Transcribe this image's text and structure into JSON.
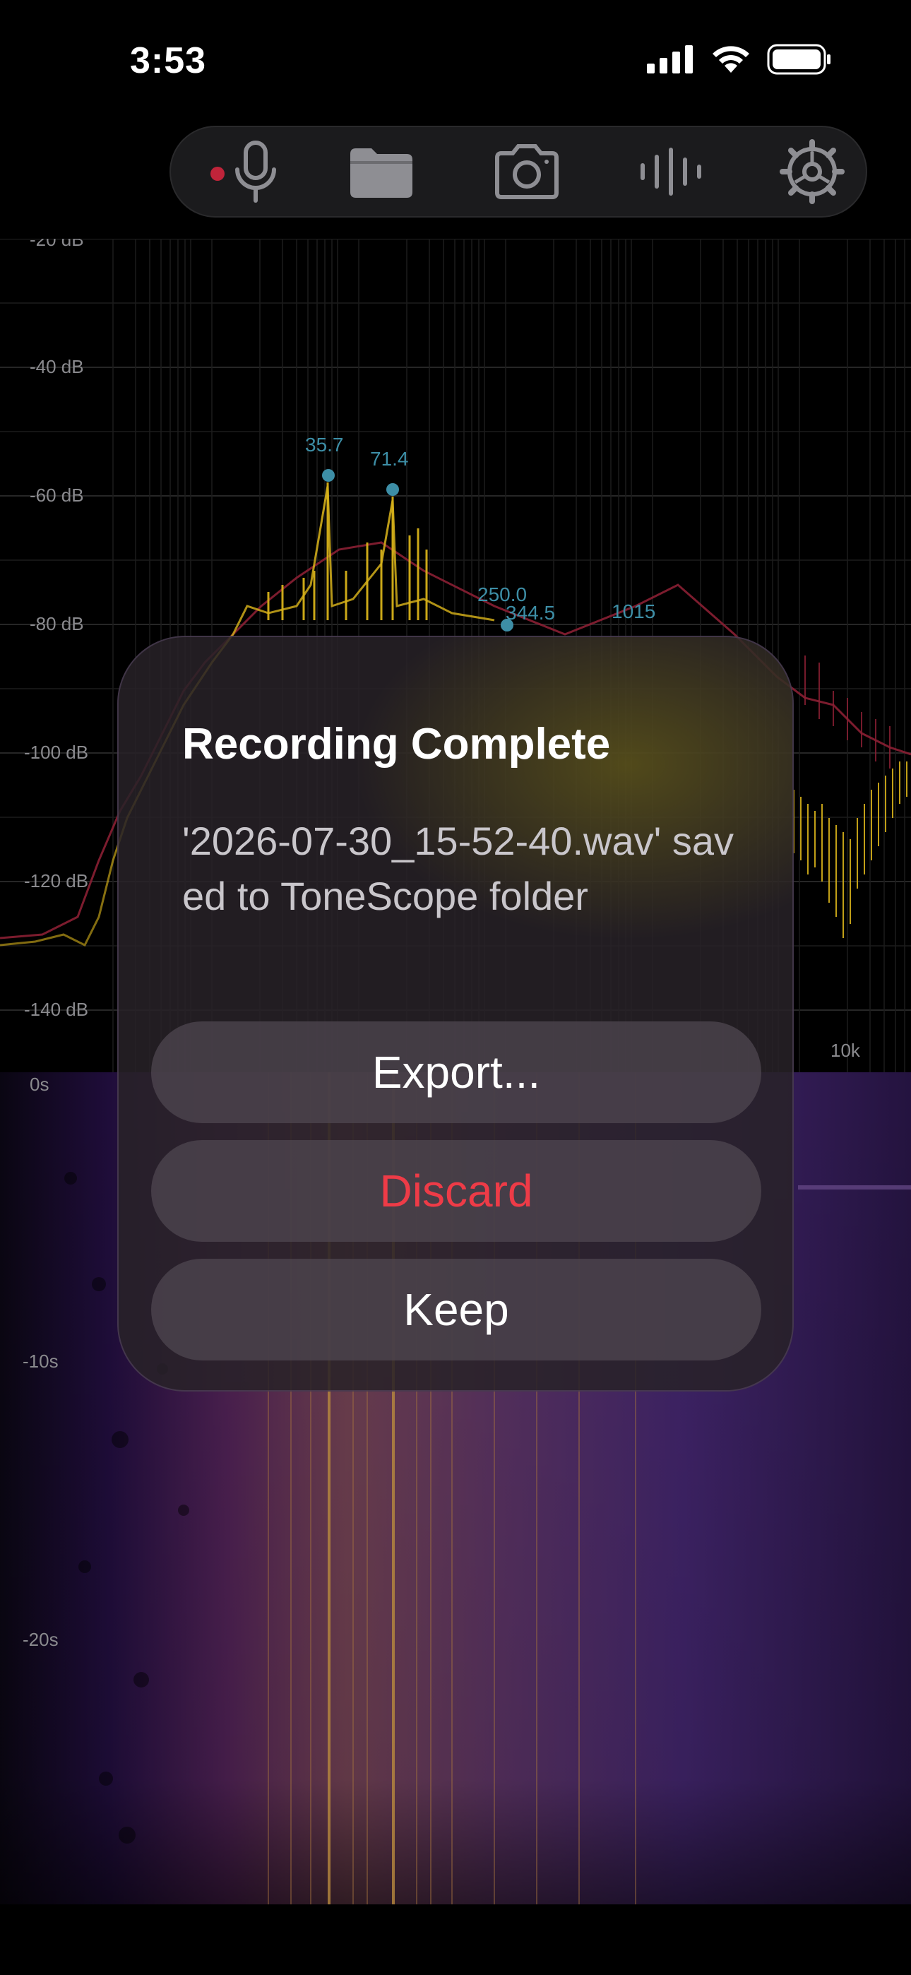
{
  "status_bar": {
    "time": "3:53"
  },
  "toolbar": {
    "items": [
      {
        "icon": "microphone-icon",
        "recording": true
      },
      {
        "icon": "folder-icon"
      },
      {
        "icon": "camera-icon"
      },
      {
        "icon": "waveform-icon"
      },
      {
        "icon": "gear-icon"
      }
    ],
    "record_indicator_color": "#c0243a"
  },
  "spectrum": {
    "db_labels": [
      "-20 dB",
      "-40 dB",
      "-60 dB",
      "-80 dB",
      "-100 dB",
      "-120 dB",
      "-140 dB"
    ],
    "freq_labels": [
      "10k"
    ],
    "peaks": [
      "35.7",
      "71.4",
      "250.0",
      "344.5",
      "1015"
    ],
    "peak_color": "#3d8ea6",
    "trace_colors": {
      "primary": "#d6b11a",
      "secondary": "#8a1f33"
    }
  },
  "spectrogram": {
    "time_labels": [
      "0s",
      "-10s",
      "-20s"
    ]
  },
  "dialog": {
    "title": "Recording Complete",
    "message": "'2026-07-30_15-52-40.wav' saved to ToneScope folder",
    "buttons": {
      "export": "Export...",
      "discard": "Discard",
      "keep": "Keep"
    },
    "discard_color": "#ee3b47"
  }
}
